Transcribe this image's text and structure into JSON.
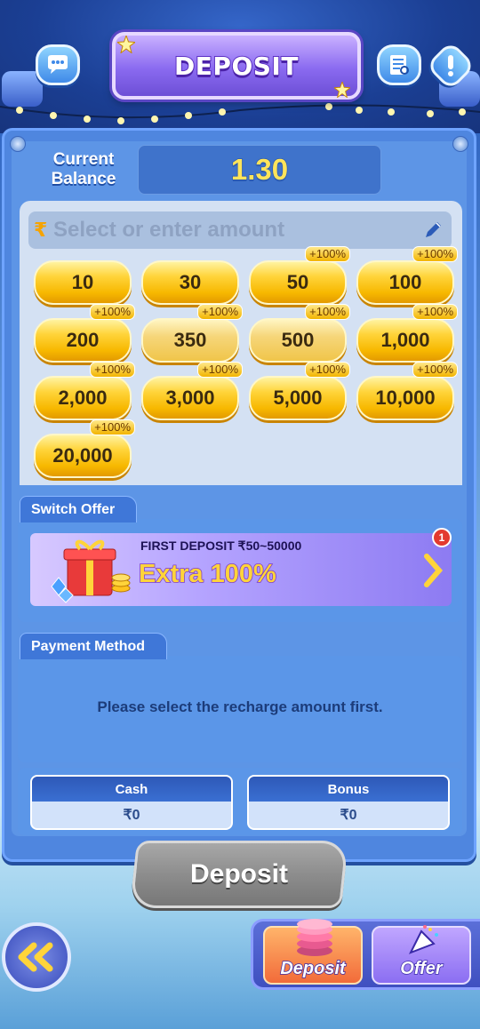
{
  "header": {
    "title": "DEPOSIT",
    "support_icon": "chat-bubble-icon",
    "records_icon": "records-icon",
    "info_icon": "exclamation-icon"
  },
  "balance": {
    "label": "Current Balance",
    "value": "1.30"
  },
  "amount_input": {
    "placeholder": "Select or enter amount",
    "icon": "rupee-icon",
    "edit_icon": "pencil-icon"
  },
  "amounts": [
    {
      "value": "10",
      "badge": ""
    },
    {
      "value": "30",
      "badge": ""
    },
    {
      "value": "50",
      "badge": "+100%"
    },
    {
      "value": "100",
      "badge": "+100%"
    },
    {
      "value": "200",
      "badge": "+100%"
    },
    {
      "value": "350",
      "badge": "+100%"
    },
    {
      "value": "500",
      "badge": "+100%"
    },
    {
      "value": "1,000",
      "badge": "+100%"
    },
    {
      "value": "2,000",
      "badge": "+100%"
    },
    {
      "value": "3,000",
      "badge": "+100%"
    },
    {
      "value": "5,000",
      "badge": "+100%"
    },
    {
      "value": "10,000",
      "badge": "+100%"
    },
    {
      "value": "20,000",
      "badge": "+100%"
    }
  ],
  "offer": {
    "tab_label": "Switch Offer",
    "subtitle": "FIRST DEPOSIT ₹50~50000",
    "headline": "Extra 100%",
    "notification_count": "1"
  },
  "payment": {
    "tab_label": "Payment Method",
    "message": "Please select the recharge amount first."
  },
  "wallet": {
    "cash_label": "Cash",
    "cash_value": "₹0",
    "bonus_label": "Bonus",
    "bonus_value": "₹0"
  },
  "deposit_button": "Deposit",
  "bottom_nav": {
    "deposit_label": "Deposit",
    "offer_label": "Offer"
  },
  "colors": {
    "accent_gold": "#ffd43a",
    "panel_blue": "#4f86df",
    "title_purple": "#8a6af0"
  }
}
